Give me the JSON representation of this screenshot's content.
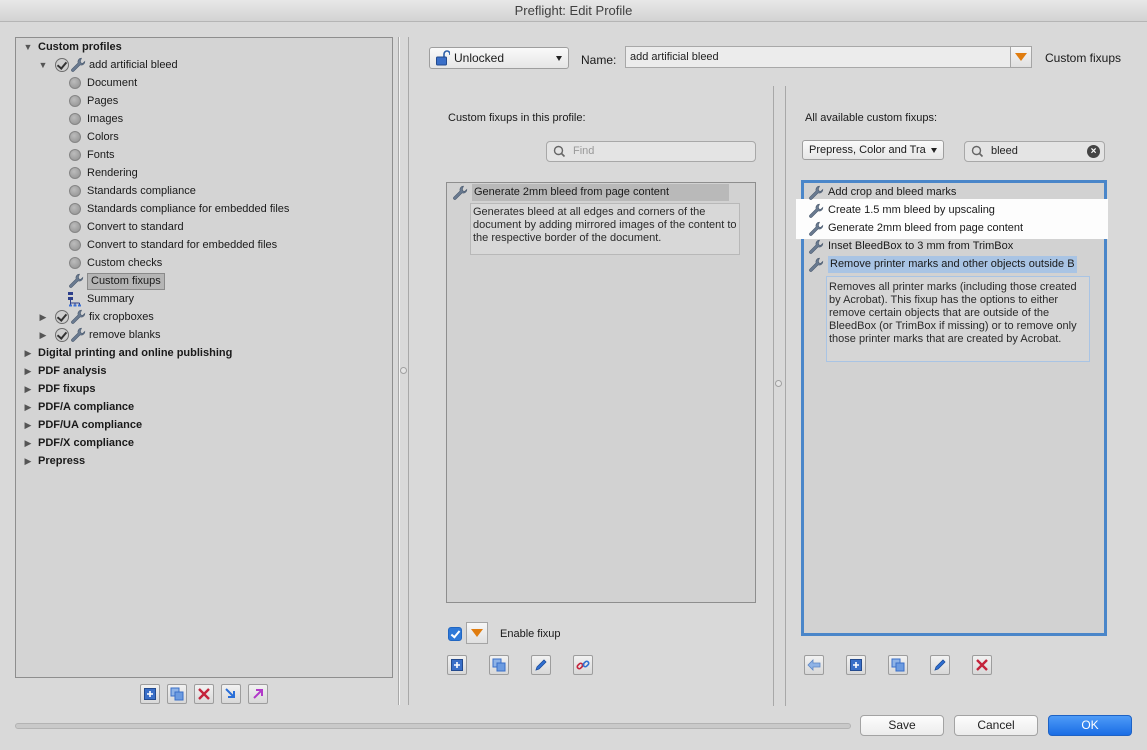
{
  "window": {
    "title": "Preflight: Edit Profile"
  },
  "tree": {
    "root": "Custom profiles",
    "profile": "add artificial bleed",
    "children": [
      "Document",
      "Pages",
      "Images",
      "Colors",
      "Fonts",
      "Rendering",
      "Standards compliance",
      "Standards compliance for embedded files",
      "Convert to standard",
      "Convert to standard for embedded files",
      "Custom checks",
      "Custom fixups",
      "Summary"
    ],
    "siblings": [
      "fix cropboxes",
      "remove blanks"
    ],
    "groups": [
      "Digital printing and online publishing",
      "PDF analysis",
      "PDF fixups",
      "PDF/A compliance",
      "PDF/UA compliance",
      "PDF/X compliance",
      "Prepress"
    ],
    "selected": "Custom fixups"
  },
  "tree_toolbar": {
    "icons": [
      "new-profile-icon",
      "duplicate-profile-icon",
      "delete-profile-icon",
      "import-profile-icon",
      "export-profile-icon"
    ]
  },
  "header": {
    "lock_value": "Unlocked",
    "name_label": "Name:",
    "name_value": "add artificial bleed",
    "section_title": "Custom fixups"
  },
  "profile_fixups": {
    "heading": "Custom fixups in this profile:",
    "search_placeholder": "Find",
    "items": [
      {
        "label": "Generate 2mm bleed from page content",
        "description": "Generates bleed at all edges and corners of the document by adding mirrored images of the content to the respective border of the document."
      }
    ],
    "enable_label": "Enable fixup",
    "enable_checked": true
  },
  "available_fixups": {
    "heading": "All available custom fixups:",
    "category": "Prepress, Color and Tra",
    "search_value": "bleed",
    "items": [
      "Add crop and bleed marks",
      "Create 1.5 mm bleed by upscaling",
      "Generate 2mm bleed from page content",
      "Inset BleedBox to 3 mm from TrimBox",
      "Remove printer marks and other objects outside B"
    ],
    "selected_description": "Removes all printer marks (including those created by Acrobat). This fixup has the options to either remove certain objects that are outside of the BleedBox (or TrimBox if missing) or to remove only those printer marks that are created by Acrobat."
  },
  "footer": {
    "save": "Save",
    "cancel": "Cancel",
    "ok": "OK",
    "progress": 0
  },
  "colors": {
    "accent": "#4a86c9",
    "primary_button": "#1a6de5",
    "selection": "#b5b5b5",
    "highlight": "#a9c4e4",
    "orange": "#e07d10"
  }
}
